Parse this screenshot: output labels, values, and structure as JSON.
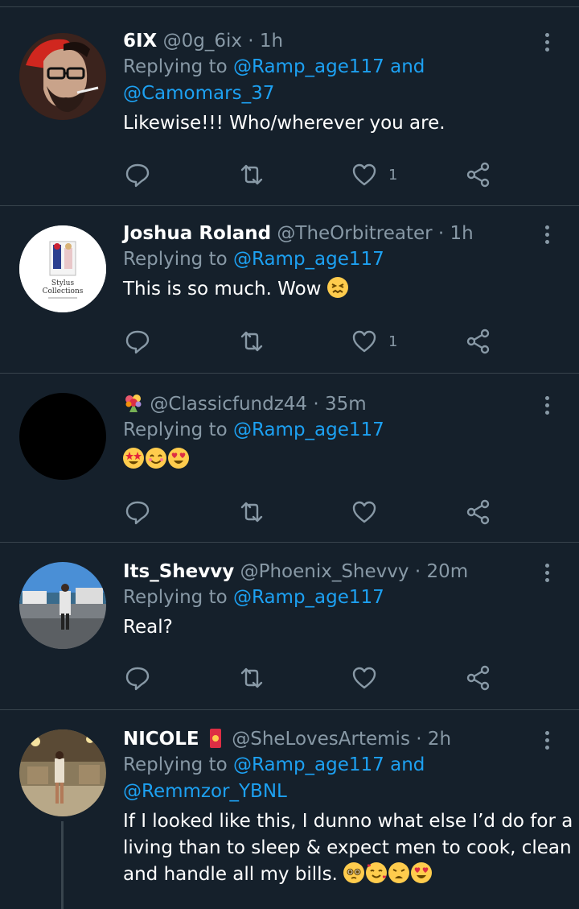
{
  "tweets": [
    {
      "name": "6IX",
      "handle": "@0g_6ix",
      "time": "1h",
      "replying_prefix": "Replying to",
      "replying_line1": "@Ramp_age117 and",
      "replying_line2": "@Camomars_37",
      "body": "Likewise!!! Who/wherever you are.",
      "likes": "1",
      "avatar": "portrait-glasses-cigarette"
    },
    {
      "name": "Joshua Roland",
      "handle": "@TheOrbitreater",
      "time": "1h",
      "replying_prefix": "Replying to",
      "replying_line1": "@Ramp_age117",
      "body": "This is so much. Wow",
      "emoji": "confounded-face",
      "likes": "1",
      "avatar_text_1": "Stylus",
      "avatar_text_2": "Collections"
    },
    {
      "name_emoji": "bouquet",
      "handle": "@Classicfundz44",
      "time": "35m",
      "replying_prefix": "Replying to",
      "replying_line1": "@Ramp_age117",
      "body_emojis": [
        "star-struck",
        "smiling-face",
        "heart-eyes"
      ],
      "avatar": "black-circle"
    },
    {
      "name": "Its_Shevvy",
      "handle": "@Phoenix_Shevvy",
      "time": "20m",
      "replying_prefix": "Replying to",
      "replying_line1": "@Ramp_age117",
      "body": "Real?",
      "avatar": "harbor-photo"
    },
    {
      "name": "NICOLE",
      "name_emoji": "red-envelope",
      "handle": "@SheLovesArtemis",
      "time": "2h",
      "replying_prefix": "Replying to",
      "replying_line1": "@Ramp_age117 and",
      "replying_line2": "@Remmzor_YBNL",
      "body_line1": "If I looked like this, I dunno what else I’d do for a",
      "body_line2": "living than to sleep & expect men to cook, clean",
      "body_line3": "and handle all my bills.",
      "body_emojis": [
        "pleading-face",
        "smiling-face-with-hearts",
        "weary-face",
        "heart-eyes"
      ],
      "avatar": "woman-photo"
    }
  ],
  "colors": {
    "background": "#15202b",
    "secondary_text": "#8899a6",
    "link": "#1da1f2",
    "divider": "#38444d"
  },
  "icons": [
    "reply-icon",
    "retweet-icon",
    "like-icon",
    "share-icon",
    "more-icon"
  ]
}
